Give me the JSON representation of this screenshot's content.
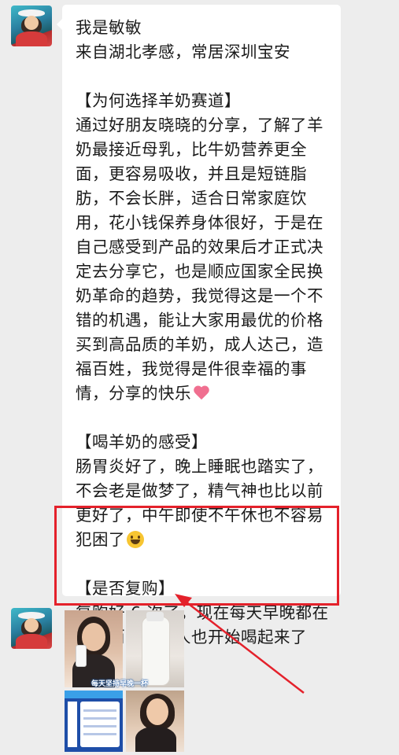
{
  "chat": {
    "message_lines": [
      "我是敏敏",
      "来自湖北孝感，常居深圳宝安",
      "",
      "【为何选择羊奶赛道】",
      "通过好朋友晓晓的分享，了解了羊",
      "奶最接近母乳，比牛奶营养更全",
      "面，更容易吸收，并且是短链脂",
      "肪，不会长胖，适合日常家庭饮",
      "用，花小钱保养身体很好，于是在",
      "自己感受到产品的效果后才正式决",
      "定去分享它，也是顺应国家全民换",
      "奶革命的趋势，我觉得这是一个不",
      "错的机遇，能让大家用最优的价格",
      "买到高品质的羊奶，成人达己，造",
      "福百姓，我觉得是件很幸福的事",
      "情，分享的快乐",
      "",
      "【喝羊奶的感受】",
      "肠胃炎好了，晚上睡眠也踏实了，",
      "不会老是做梦了，精气神也比以前",
      "更好了，中午即使不午休也不容易",
      "犯困了",
      "",
      "【是否复购】",
      "复购好 6 次了，现在每天早晚都在",
      "喝，而且家里人也开始喝起来了"
    ],
    "emoji_icons": [
      "heart-icon",
      "grinning-face-icon"
    ],
    "image_caption": "每天坚持早晚一杯"
  },
  "colors": {
    "background": "#ededed",
    "bubble": "#ffffff",
    "highlight": "#e4212b"
  }
}
